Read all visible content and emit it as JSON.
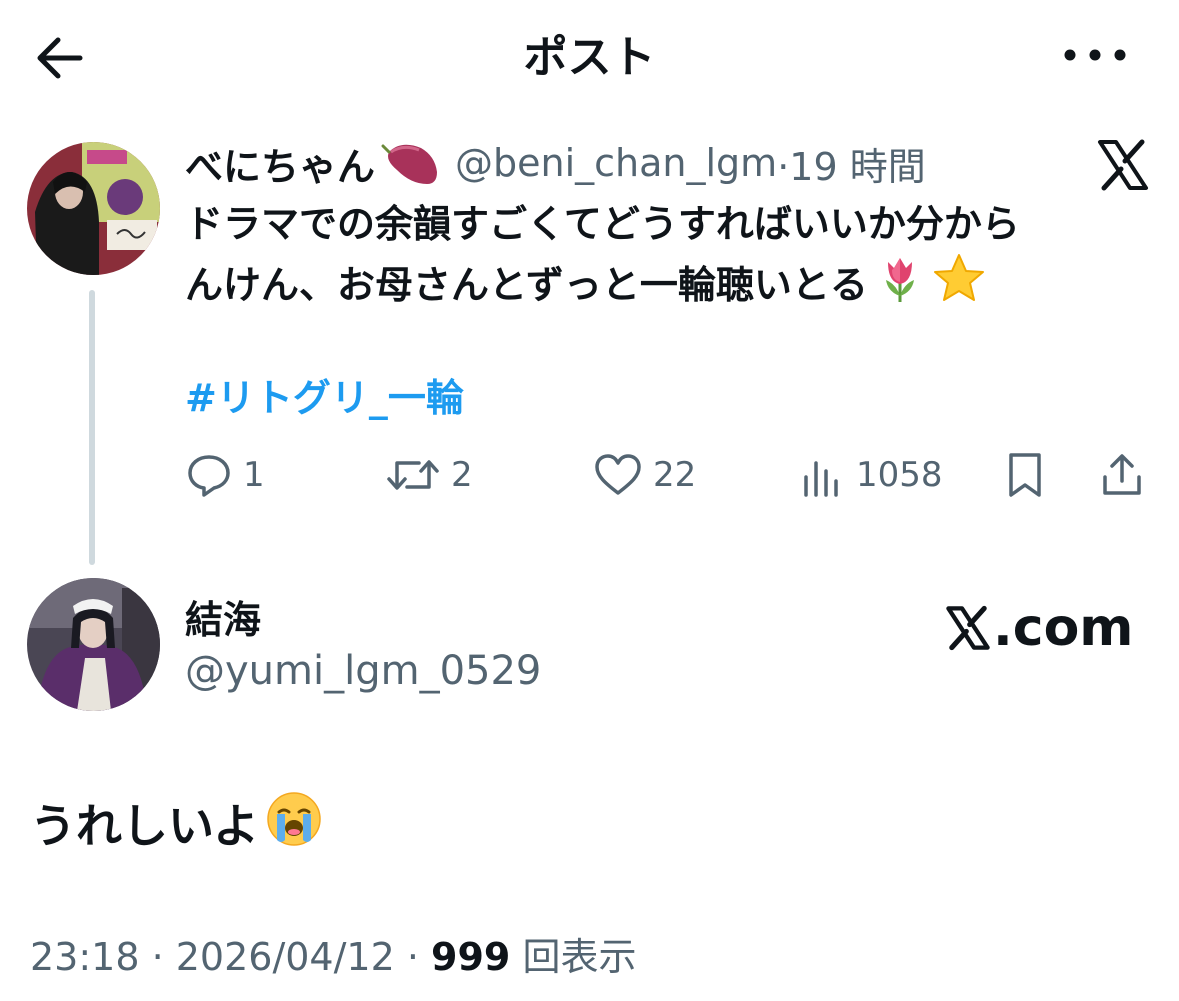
{
  "header": {
    "title": "ポスト",
    "back_icon": "back-arrow-icon",
    "more_icon": "more-icon"
  },
  "quoted_post": {
    "author_name": "べにちゃん",
    "author_emoji": "sweet-potato",
    "handle": "@beni_chan_lgm",
    "time": "·19 時間",
    "text_line1": "ドラマでの余韻すごくてどうすればいいか分から",
    "text_line2": "んけん、お母さんとずっと一輪聴いとる",
    "text_emojis": [
      "tulip",
      "star"
    ],
    "hashtag": "#リトグリ_一輪",
    "platform_icon": "x-logo-icon",
    "actions": {
      "reply": "1",
      "repost": "2",
      "like": "22",
      "views": "1058"
    }
  },
  "reply_post": {
    "author_name": "結海",
    "handle": "@yumi_lgm_0529",
    "source_label": ".com",
    "text": "うれしいよ",
    "text_emoji": "loudly-crying-face",
    "timestamp": "23:18 · 2026/04/12 ·",
    "views_count": "999",
    "views_label": "回表示"
  },
  "colors": {
    "text": "#0f1419",
    "secondary": "#536471",
    "link": "#1d9bf0",
    "thread_line": "#cfd9de"
  }
}
